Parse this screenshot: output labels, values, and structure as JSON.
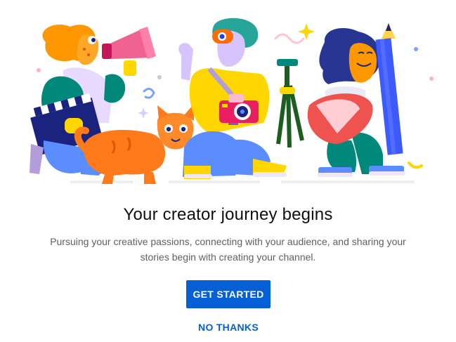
{
  "dialog": {
    "title": "Your creator journey begins",
    "subtitle": "Pursuing your creative passions, connecting with your audience, and sharing your stories begin with creating your channel.",
    "primary_button": "GET STARTED",
    "secondary_button": "NO THANKS"
  },
  "illustration": {
    "icons": [
      "megaphone-icon",
      "clapperboard-icon",
      "camera-icon",
      "tripod-icon",
      "pencil-icon",
      "cat-icon"
    ]
  },
  "colors": {
    "accent": "#065fd4",
    "title": "#0f0f0f",
    "subtitle": "#606060"
  }
}
